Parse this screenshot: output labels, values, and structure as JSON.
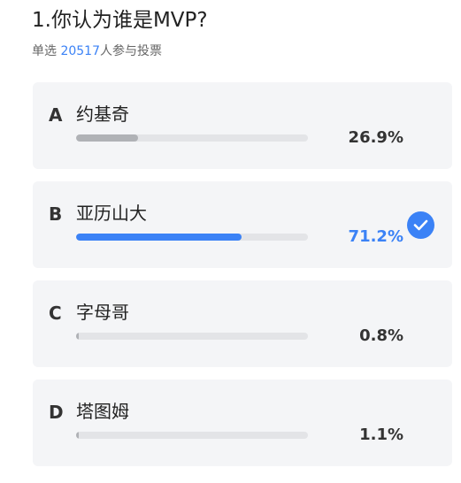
{
  "question": {
    "title": "1.你认为谁是MVP?",
    "type_label": "单选",
    "vote_count": "20517",
    "vote_suffix": "人参与投票"
  },
  "colors": {
    "accent": "#3b82f6",
    "bar_default": "#b0b2b6",
    "track": "#e3e4e7",
    "card_bg": "#f4f5f7"
  },
  "options": [
    {
      "letter": "A",
      "name": "约基奇",
      "percent": "26.9%",
      "value": 26.9,
      "selected": false
    },
    {
      "letter": "B",
      "name": "亚历山大",
      "percent": "71.2%",
      "value": 71.2,
      "selected": true,
      "icon": "check-circle-icon"
    },
    {
      "letter": "C",
      "name": "字母哥",
      "percent": "0.8%",
      "value": 0.8,
      "selected": false
    },
    {
      "letter": "D",
      "name": "塔图姆",
      "percent": "1.1%",
      "value": 1.1,
      "selected": false
    }
  ]
}
